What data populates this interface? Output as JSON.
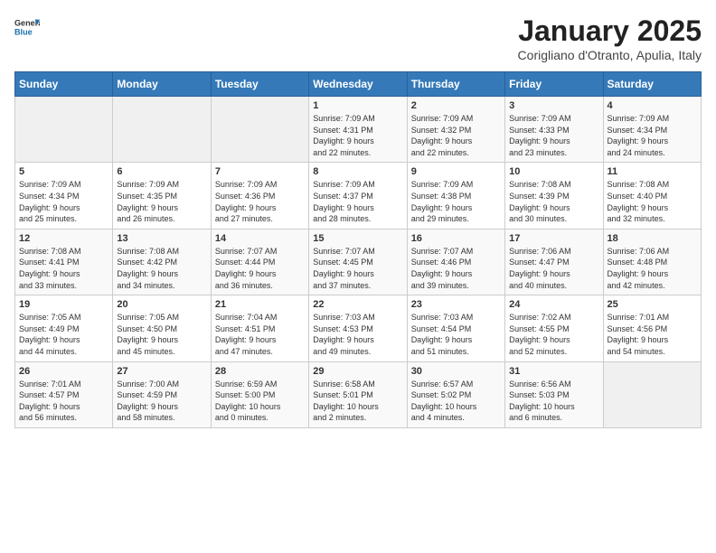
{
  "header": {
    "logo": {
      "general": "General",
      "blue": "Blue"
    },
    "title": "January 2025",
    "location": "Corigliano d'Otranto, Apulia, Italy"
  },
  "calendar": {
    "weekdays": [
      "Sunday",
      "Monday",
      "Tuesday",
      "Wednesday",
      "Thursday",
      "Friday",
      "Saturday"
    ],
    "weeks": [
      [
        {
          "day": "",
          "info": ""
        },
        {
          "day": "",
          "info": ""
        },
        {
          "day": "",
          "info": ""
        },
        {
          "day": "1",
          "info": "Sunrise: 7:09 AM\nSunset: 4:31 PM\nDaylight: 9 hours\nand 22 minutes."
        },
        {
          "day": "2",
          "info": "Sunrise: 7:09 AM\nSunset: 4:32 PM\nDaylight: 9 hours\nand 22 minutes."
        },
        {
          "day": "3",
          "info": "Sunrise: 7:09 AM\nSunset: 4:33 PM\nDaylight: 9 hours\nand 23 minutes."
        },
        {
          "day": "4",
          "info": "Sunrise: 7:09 AM\nSunset: 4:34 PM\nDaylight: 9 hours\nand 24 minutes."
        }
      ],
      [
        {
          "day": "5",
          "info": "Sunrise: 7:09 AM\nSunset: 4:34 PM\nDaylight: 9 hours\nand 25 minutes."
        },
        {
          "day": "6",
          "info": "Sunrise: 7:09 AM\nSunset: 4:35 PM\nDaylight: 9 hours\nand 26 minutes."
        },
        {
          "day": "7",
          "info": "Sunrise: 7:09 AM\nSunset: 4:36 PM\nDaylight: 9 hours\nand 27 minutes."
        },
        {
          "day": "8",
          "info": "Sunrise: 7:09 AM\nSunset: 4:37 PM\nDaylight: 9 hours\nand 28 minutes."
        },
        {
          "day": "9",
          "info": "Sunrise: 7:09 AM\nSunset: 4:38 PM\nDaylight: 9 hours\nand 29 minutes."
        },
        {
          "day": "10",
          "info": "Sunrise: 7:08 AM\nSunset: 4:39 PM\nDaylight: 9 hours\nand 30 minutes."
        },
        {
          "day": "11",
          "info": "Sunrise: 7:08 AM\nSunset: 4:40 PM\nDaylight: 9 hours\nand 32 minutes."
        }
      ],
      [
        {
          "day": "12",
          "info": "Sunrise: 7:08 AM\nSunset: 4:41 PM\nDaylight: 9 hours\nand 33 minutes."
        },
        {
          "day": "13",
          "info": "Sunrise: 7:08 AM\nSunset: 4:42 PM\nDaylight: 9 hours\nand 34 minutes."
        },
        {
          "day": "14",
          "info": "Sunrise: 7:07 AM\nSunset: 4:44 PM\nDaylight: 9 hours\nand 36 minutes."
        },
        {
          "day": "15",
          "info": "Sunrise: 7:07 AM\nSunset: 4:45 PM\nDaylight: 9 hours\nand 37 minutes."
        },
        {
          "day": "16",
          "info": "Sunrise: 7:07 AM\nSunset: 4:46 PM\nDaylight: 9 hours\nand 39 minutes."
        },
        {
          "day": "17",
          "info": "Sunrise: 7:06 AM\nSunset: 4:47 PM\nDaylight: 9 hours\nand 40 minutes."
        },
        {
          "day": "18",
          "info": "Sunrise: 7:06 AM\nSunset: 4:48 PM\nDaylight: 9 hours\nand 42 minutes."
        }
      ],
      [
        {
          "day": "19",
          "info": "Sunrise: 7:05 AM\nSunset: 4:49 PM\nDaylight: 9 hours\nand 44 minutes."
        },
        {
          "day": "20",
          "info": "Sunrise: 7:05 AM\nSunset: 4:50 PM\nDaylight: 9 hours\nand 45 minutes."
        },
        {
          "day": "21",
          "info": "Sunrise: 7:04 AM\nSunset: 4:51 PM\nDaylight: 9 hours\nand 47 minutes."
        },
        {
          "day": "22",
          "info": "Sunrise: 7:03 AM\nSunset: 4:53 PM\nDaylight: 9 hours\nand 49 minutes."
        },
        {
          "day": "23",
          "info": "Sunrise: 7:03 AM\nSunset: 4:54 PM\nDaylight: 9 hours\nand 51 minutes."
        },
        {
          "day": "24",
          "info": "Sunrise: 7:02 AM\nSunset: 4:55 PM\nDaylight: 9 hours\nand 52 minutes."
        },
        {
          "day": "25",
          "info": "Sunrise: 7:01 AM\nSunset: 4:56 PM\nDaylight: 9 hours\nand 54 minutes."
        }
      ],
      [
        {
          "day": "26",
          "info": "Sunrise: 7:01 AM\nSunset: 4:57 PM\nDaylight: 9 hours\nand 56 minutes."
        },
        {
          "day": "27",
          "info": "Sunrise: 7:00 AM\nSunset: 4:59 PM\nDaylight: 9 hours\nand 58 minutes."
        },
        {
          "day": "28",
          "info": "Sunrise: 6:59 AM\nSunset: 5:00 PM\nDaylight: 10 hours\nand 0 minutes."
        },
        {
          "day": "29",
          "info": "Sunrise: 6:58 AM\nSunset: 5:01 PM\nDaylight: 10 hours\nand 2 minutes."
        },
        {
          "day": "30",
          "info": "Sunrise: 6:57 AM\nSunset: 5:02 PM\nDaylight: 10 hours\nand 4 minutes."
        },
        {
          "day": "31",
          "info": "Sunrise: 6:56 AM\nSunset: 5:03 PM\nDaylight: 10 hours\nand 6 minutes."
        },
        {
          "day": "",
          "info": ""
        }
      ]
    ]
  }
}
